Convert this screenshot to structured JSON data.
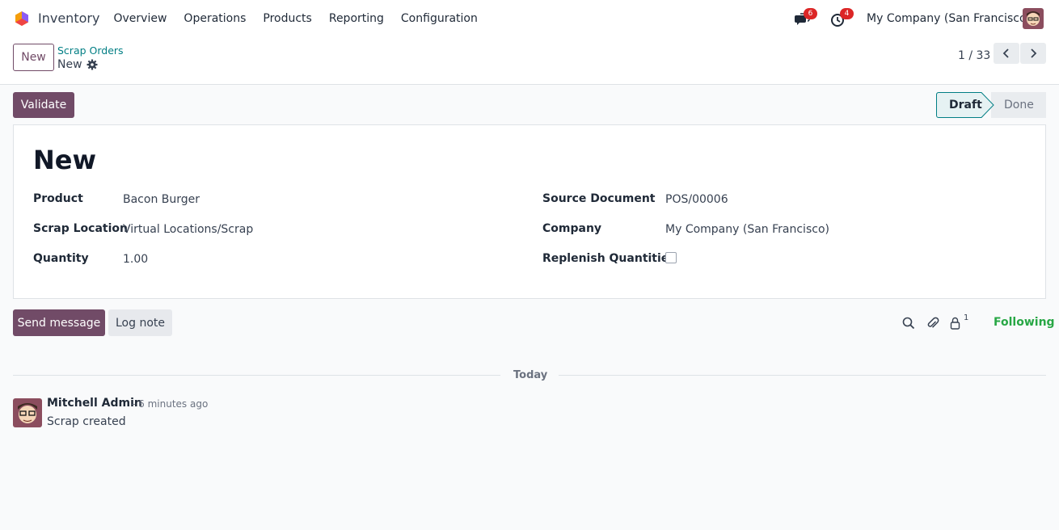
{
  "navbar": {
    "app_name": "Inventory",
    "menu": [
      "Overview",
      "Operations",
      "Products",
      "Reporting",
      "Configuration"
    ],
    "messages_count": "6",
    "activities_count": "4",
    "company": "My Company (San Francisco)"
  },
  "control_panel": {
    "new_label": "New",
    "breadcrumb_parent": "Scrap Orders",
    "breadcrumb_current": "New",
    "pager": "1 / 33"
  },
  "status_bar": {
    "validate_label": "Validate",
    "stages": [
      "Draft",
      "Done"
    ],
    "active_stage": "Draft"
  },
  "form": {
    "title": "New",
    "left_fields": [
      {
        "label": "Product",
        "value": "Bacon Burger"
      },
      {
        "label": "Scrap Location",
        "value": "Virtual Locations/Scrap"
      },
      {
        "label": "Quantity",
        "value": "1.00"
      }
    ],
    "right_fields": [
      {
        "label": "Source Document",
        "value": "POS/00006"
      },
      {
        "label": "Company",
        "value": "My Company (San Francisco)"
      },
      {
        "label": "Replenish Quantities",
        "value": ""
      }
    ],
    "replenish_checked": false
  },
  "chatter": {
    "send_label": "Send message",
    "log_label": "Log note",
    "followers_count": "1",
    "following_label": "Following",
    "date_separator": "Today",
    "messages": [
      {
        "author": "Mitchell Admin",
        "time": "- 6 minutes ago",
        "body": "Scrap created"
      }
    ]
  },
  "colors": {
    "brand": "#714B67",
    "link": "#017e84",
    "following": "#28a745",
    "badge": "#dc2626"
  }
}
